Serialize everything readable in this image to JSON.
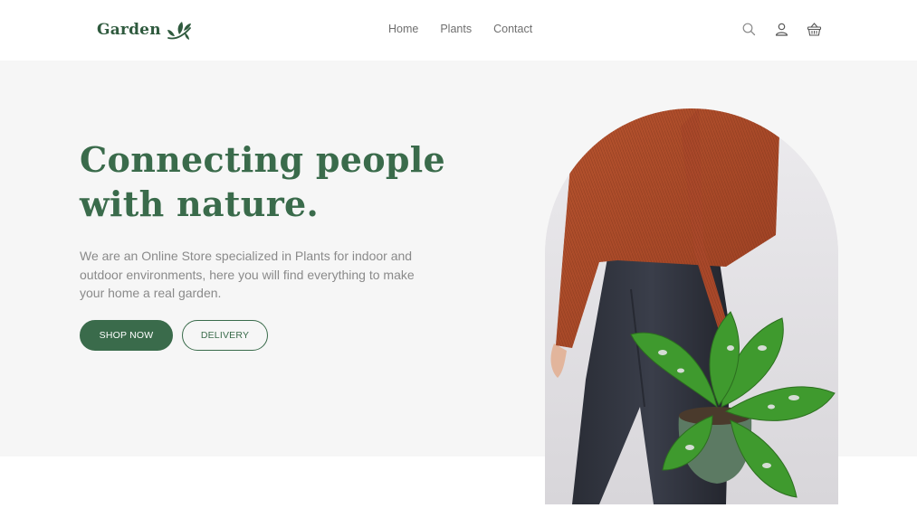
{
  "header": {
    "logo_text": "Garden",
    "nav": [
      {
        "label": "Home"
      },
      {
        "label": "Plants"
      },
      {
        "label": "Contact"
      }
    ],
    "icons": [
      "search-icon",
      "user-icon",
      "basket-icon"
    ]
  },
  "hero": {
    "title_line1": "Connecting people",
    "title_line2": "with nature.",
    "description": "We are an Online Store specialized in Plants for indoor and outdoor environments, here you will find everything to make your home a real garden.",
    "primary_button": "SHOP NOW",
    "secondary_button": "DELIVERY",
    "image": "person-holding-plant-photo"
  },
  "colors": {
    "brand_green": "#3a6b4b",
    "hero_background": "#f6f6f6",
    "text_gray": "#8a8a8a"
  }
}
